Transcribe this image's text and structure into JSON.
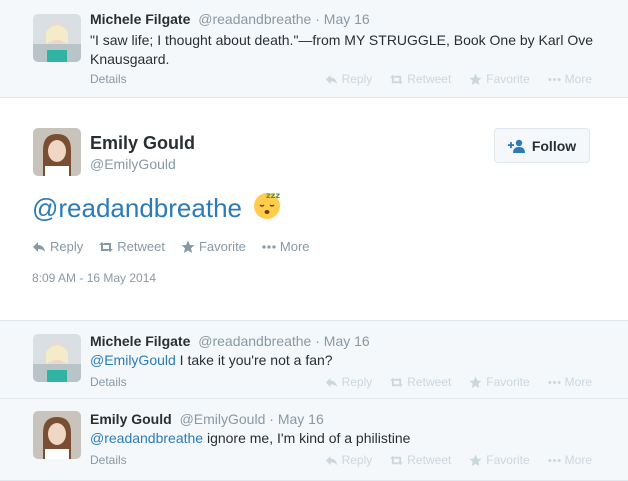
{
  "tweets_before": [
    {
      "name": "Michele Filgate",
      "handle": "@readandbreathe",
      "sep": "·",
      "time": "May 16",
      "text": "\"I saw life; I thought about death.\"—from MY STRUGGLE, Book One by Karl Ove Knausgaard.",
      "details": "Details",
      "actions": {
        "reply": "Reply",
        "retweet": "Retweet",
        "favorite": "Favorite",
        "more": "More"
      }
    }
  ],
  "main_tweet": {
    "name": "Emily Gould",
    "handle": "@EmilyGould",
    "follow_label": "Follow",
    "text_mention": "@readandbreathe",
    "emoji": "😴",
    "actions": {
      "reply": "Reply",
      "retweet": "Retweet",
      "favorite": "Favorite",
      "more": "More"
    },
    "timestamp": "8:09 AM - 16 May 2014"
  },
  "replies": [
    {
      "name": "Michele Filgate",
      "handle": "@readandbreathe",
      "sep": "·",
      "time": "May 16",
      "mention": "@EmilyGould",
      "text": " I take it you're not a fan?",
      "details": "Details",
      "actions": {
        "reply": "Reply",
        "retweet": "Retweet",
        "favorite": "Favorite",
        "more": "More"
      }
    },
    {
      "name": "Emily Gould",
      "handle": "@EmilyGould",
      "sep": "·",
      "time": "May 16",
      "mention": "@readandbreathe",
      "text": " ignore me, I'm kind of a philistine",
      "details": "Details",
      "actions": {
        "reply": "Reply",
        "retweet": "Retweet",
        "favorite": "Favorite",
        "more": "More"
      }
    }
  ],
  "colors": {
    "link": "#2b7bb9",
    "muted": "#8899a6",
    "text": "#292f33",
    "reply_bg": "#f5f8fa"
  }
}
